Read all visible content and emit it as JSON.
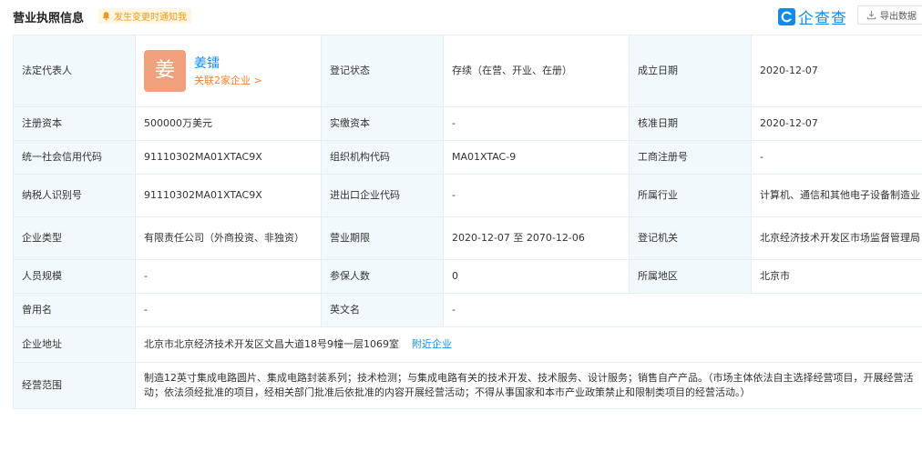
{
  "header": {
    "title": "营业执照信息",
    "notify_label": "发生变更时通知我",
    "brand_name": "企查查",
    "export_label": "导出数据",
    "accent_color": "#128bed"
  },
  "table": {
    "legal_rep_label": "法定代表人",
    "legal_rep_avatar": "姜",
    "legal_rep_name": "姜镭",
    "legal_rep_related": "关联2家企业 >",
    "reg_status_label": "登记状态",
    "reg_status_value": "存续（在营、开业、在册）",
    "established_label": "成立日期",
    "established_value": "2020-12-07",
    "reg_capital_label": "注册资本",
    "reg_capital_value": "500000万美元",
    "paid_capital_label": "实缴资本",
    "paid_capital_value": "-",
    "approval_date_label": "核准日期",
    "approval_date_value": "2020-12-07",
    "credit_code_label": "统一社会信用代码",
    "credit_code_value": "91110302MA01XTAC9X",
    "org_code_label": "组织机构代码",
    "org_code_value": "MA01XTAC-9",
    "biz_reg_no_label": "工商注册号",
    "biz_reg_no_value": "-",
    "taxpayer_id_label": "纳税人识别号",
    "taxpayer_id_value": "91110302MA01XTAC9X",
    "import_export_label": "进出口企业代码",
    "import_export_value": "-",
    "industry_label": "所属行业",
    "industry_value": "计算机、通信和其他电子设备制造业",
    "company_type_label": "企业类型",
    "company_type_value": "有限责任公司（外商投资、非独资）",
    "term_label": "营业期限",
    "term_value": "2020-12-07 至 2070-12-06",
    "authority_label": "登记机关",
    "authority_value": "北京经济技术开发区市场监督管理局",
    "staff_size_label": "人员规模",
    "staff_size_value": "-",
    "insured_label": "参保人数",
    "insured_value": "0",
    "region_label": "所属地区",
    "region_value": "北京市",
    "former_name_label": "曾用名",
    "former_name_value": "-",
    "english_name_label": "英文名",
    "english_name_value": "-",
    "address_label": "企业地址",
    "address_value": "北京市北京经济技术开发区文昌大道18号9幢一层1069室",
    "nearby_link": "附近企业",
    "scope_label": "经营范围",
    "scope_value": "制造12英寸集成电路圆片、集成电路封装系列；技术检测；与集成电路有关的技术开发、技术服务、设计服务；销售自产产品。（市场主体依法自主选择经营项目，开展经营活动；依法须经批准的项目，经相关部门批准后依批准的内容开展经营活动；不得从事国家和本市产业政策禁止和限制类项目的经营活动。）"
  }
}
